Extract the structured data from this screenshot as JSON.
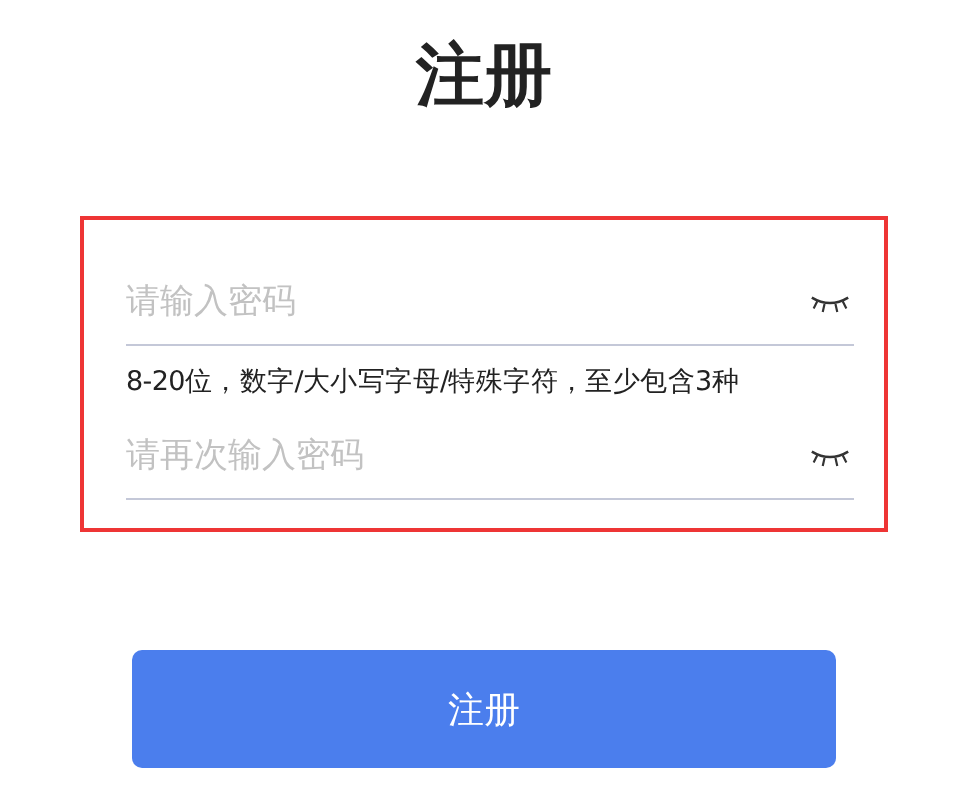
{
  "title": "注册",
  "form": {
    "highlighted": true,
    "fields": [
      {
        "placeholder": "请输入密码",
        "password_visible": false
      },
      {
        "hint": "8-20位，数字/大小写字母/特殊字符，至少包含3种",
        "placeholder": "请再次输入密码",
        "password_visible": false
      }
    ]
  },
  "submit_button": "注册"
}
